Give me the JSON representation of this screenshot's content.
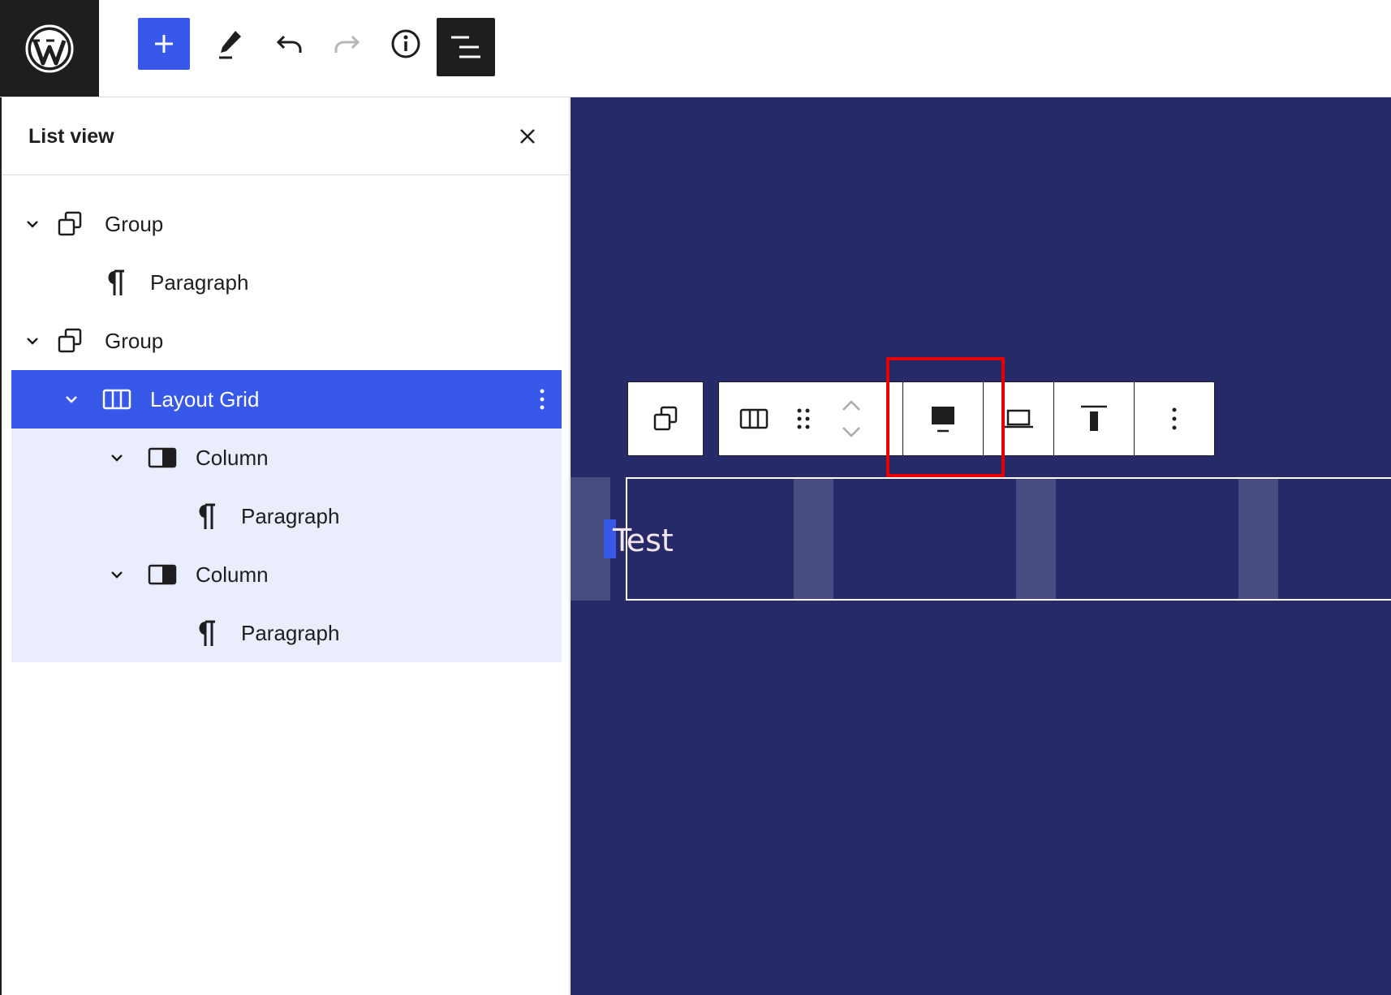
{
  "topbar": {
    "logo": "wordpress-logo",
    "buttons": [
      {
        "name": "add-block",
        "icon": "plus-icon"
      },
      {
        "name": "tools",
        "icon": "pencil-icon"
      },
      {
        "name": "undo",
        "icon": "undo-icon"
      },
      {
        "name": "redo",
        "icon": "redo-icon"
      },
      {
        "name": "details",
        "icon": "info-icon"
      },
      {
        "name": "list-view",
        "icon": "list-view-icon"
      }
    ]
  },
  "list_view": {
    "title": "List view",
    "items": [
      {
        "label": "Group",
        "icon": "group-icon",
        "level": 1,
        "expanded": true
      },
      {
        "label": "Paragraph",
        "icon": "paragraph-icon",
        "level": 2
      },
      {
        "label": "Group",
        "icon": "group-icon",
        "level": 1,
        "expanded": true
      },
      {
        "label": "Layout Grid",
        "icon": "layout-grid-icon",
        "level": 2,
        "expanded": true,
        "selected": true
      },
      {
        "label": "Column",
        "icon": "column-icon",
        "level": 3,
        "expanded": true
      },
      {
        "label": "Paragraph",
        "icon": "paragraph-icon",
        "level": 4
      },
      {
        "label": "Column",
        "icon": "column-icon",
        "level": 3,
        "expanded": true
      },
      {
        "label": "Paragraph",
        "icon": "paragraph-icon",
        "level": 4
      }
    ]
  },
  "canvas": {
    "background": "#262a69",
    "paragraph_text": "Test",
    "block_toolbar": [
      "group-icon",
      "layout-grid-icon",
      "drag-handle-icon",
      "move-up-down-icon",
      "desktop-icon",
      "laptop-icon",
      "align-top-icon",
      "more-options-icon"
    ],
    "highlight_color": "#e60000"
  },
  "colors": {
    "accent": "#3858e9",
    "dark": "#1e1e1e",
    "selected_child_bg": "#eaedfb"
  }
}
